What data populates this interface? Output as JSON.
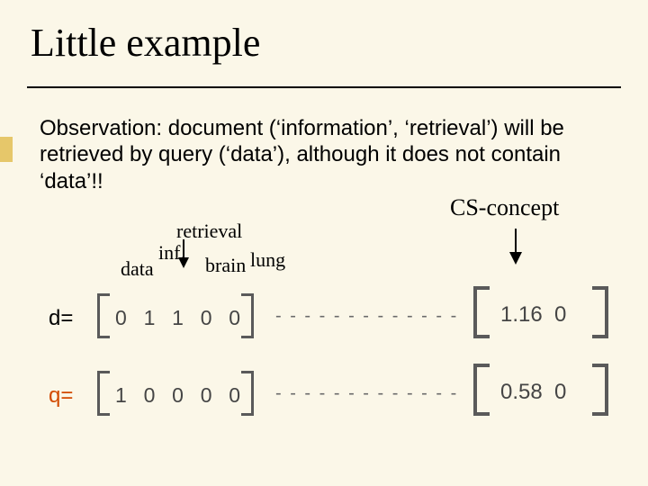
{
  "title": "Little example",
  "body": "Observation: document (‘information’, ‘retrieval’) will be retrieved by query (‘data’),  although it does not contain ‘data’!!",
  "cs_label": "CS-concept",
  "words": {
    "data": "data",
    "inf": "inf.",
    "retrieval": "retrieval",
    "brain": "brain",
    "lung": "lung"
  },
  "rows": {
    "d_label": "d=",
    "q_label": "q=",
    "d5": "0  1  1  0  0",
    "q5": "1  0  0  0  0",
    "d2": "1.16  0",
    "q2": "0.58  0"
  },
  "arrows": {
    "dash": "- - - - - - - - - - - - -"
  }
}
